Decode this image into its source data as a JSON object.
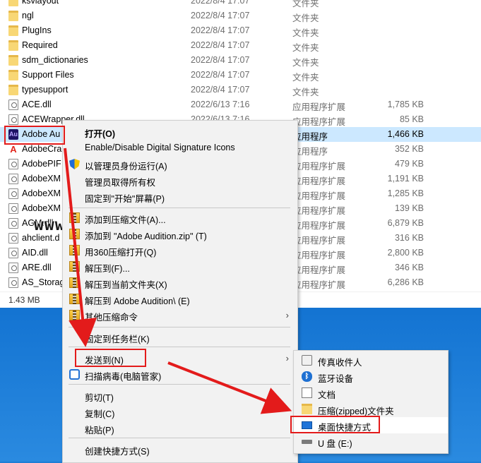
{
  "files": [
    {
      "name": "ksvlayout",
      "date": "2022/8/4 17:07",
      "type": "文件夹",
      "size": "",
      "icon": "folder"
    },
    {
      "name": "ngl",
      "date": "2022/8/4 17:07",
      "type": "文件夹",
      "size": "",
      "icon": "folder"
    },
    {
      "name": "PlugIns",
      "date": "2022/8/4 17:07",
      "type": "文件夹",
      "size": "",
      "icon": "folder"
    },
    {
      "name": "Required",
      "date": "2022/8/4 17:07",
      "type": "文件夹",
      "size": "",
      "icon": "folder"
    },
    {
      "name": "sdm_dictionaries",
      "date": "2022/8/4 17:07",
      "type": "文件夹",
      "size": "",
      "icon": "folder"
    },
    {
      "name": "Support Files",
      "date": "2022/8/4 17:07",
      "type": "文件夹",
      "size": "",
      "icon": "folder"
    },
    {
      "name": "typesupport",
      "date": "2022/8/4 17:07",
      "type": "文件夹",
      "size": "",
      "icon": "folder"
    },
    {
      "name": "ACE.dll",
      "date": "2022/6/13 7:16",
      "type": "应用程序扩展",
      "size": "1,785 KB",
      "icon": "dll"
    },
    {
      "name": "ACEWrapper.dll",
      "date": "2022/6/13 7:16",
      "type": "应用程序扩展",
      "size": "85 KB",
      "icon": "dll"
    },
    {
      "name": "Adobe Au",
      "date": "",
      "type": "应用程序",
      "size": "1,466 KB",
      "icon": "au"
    },
    {
      "name": "AdobeCra",
      "date": "",
      "type": "应用程序",
      "size": "352 KB",
      "icon": "adobe"
    },
    {
      "name": "AdobePIF",
      "date": "",
      "type": "应用程序扩展",
      "size": "479 KB",
      "icon": "dll"
    },
    {
      "name": "AdobeXM",
      "date": "",
      "type": "应用程序扩展",
      "size": "1,191 KB",
      "icon": "dll"
    },
    {
      "name": "AdobeXM",
      "date": "",
      "type": "应用程序扩展",
      "size": "1,285 KB",
      "icon": "dll"
    },
    {
      "name": "AdobeXM",
      "date": "",
      "type": "应用程序扩展",
      "size": "139 KB",
      "icon": "dll"
    },
    {
      "name": "AGM.dll",
      "date": "",
      "type": "应用程序扩展",
      "size": "6,879 KB",
      "icon": "dll"
    },
    {
      "name": "ahclient.d",
      "date": "",
      "type": "应用程序扩展",
      "size": "316 KB",
      "icon": "dll"
    },
    {
      "name": "AID.dll",
      "date": "",
      "type": "应用程序扩展",
      "size": "2,800 KB",
      "icon": "dll"
    },
    {
      "name": "ARE.dll",
      "date": "",
      "type": "应用程序扩展",
      "size": "346 KB",
      "icon": "dll"
    },
    {
      "name": "AS_Storag",
      "date": "",
      "type": "应用程序扩展",
      "size": "6,286 KB",
      "icon": "dll"
    }
  ],
  "status": {
    "size": "1.43 MB"
  },
  "watermark": "www.dgraj.com",
  "context_menu": {
    "items": [
      {
        "label": "打开(O)",
        "icon": "",
        "bold": true
      },
      {
        "label": "Enable/Disable Digital Signature Icons",
        "icon": ""
      },
      {
        "label": "以管理员身份运行(A)",
        "icon": "uac-shield-icon"
      },
      {
        "label": "管理员取得所有权",
        "icon": ""
      },
      {
        "label": "固定到\"开始\"屏幕(P)",
        "icon": ""
      },
      {
        "label": "添加到压缩文件(A)...",
        "icon": "archive-icon"
      },
      {
        "label": "添加到 \"Adobe Audition.zip\" (T)",
        "icon": "archive-icon"
      },
      {
        "label": "用360压缩打开(Q)",
        "icon": "archive-icon"
      },
      {
        "label": "解压到(F)...",
        "icon": "archive-icon"
      },
      {
        "label": "解压到当前文件夹(X)",
        "icon": "archive-icon"
      },
      {
        "label": "解压到 Adobe Audition\\ (E)",
        "icon": "archive-icon"
      },
      {
        "label": "其他压缩命令",
        "icon": "archive-icon",
        "submenu": true
      },
      {
        "label": "固定到任务栏(K)",
        "icon": ""
      },
      {
        "label": "发送到(N)",
        "icon": "",
        "submenu": true
      },
      {
        "label": "扫描病毒(电脑管家)",
        "icon": "security-shield-icon"
      },
      {
        "label": "剪切(T)",
        "icon": ""
      },
      {
        "label": "复制(C)",
        "icon": ""
      },
      {
        "label": "粘贴(P)",
        "icon": ""
      },
      {
        "label": "创建快捷方式(S)",
        "icon": ""
      }
    ]
  },
  "send_to_menu": {
    "items": [
      {
        "label": "传真收件人",
        "icon": "fax-icon"
      },
      {
        "label": "蓝牙设备",
        "icon": "bluetooth-icon"
      },
      {
        "label": "文档",
        "icon": "document-icon"
      },
      {
        "label": "压缩(zipped)文件夹",
        "icon": "zip-folder-icon"
      },
      {
        "label": "桌面快捷方式",
        "icon": "desktop-icon",
        "highlighted": true
      },
      {
        "label": "U 盘 (E:)",
        "icon": "usb-drive-icon"
      }
    ]
  },
  "colors": {
    "highlight_red": "#e31b1b",
    "selection": "#cce8ff",
    "desktop": "#1678d8"
  }
}
